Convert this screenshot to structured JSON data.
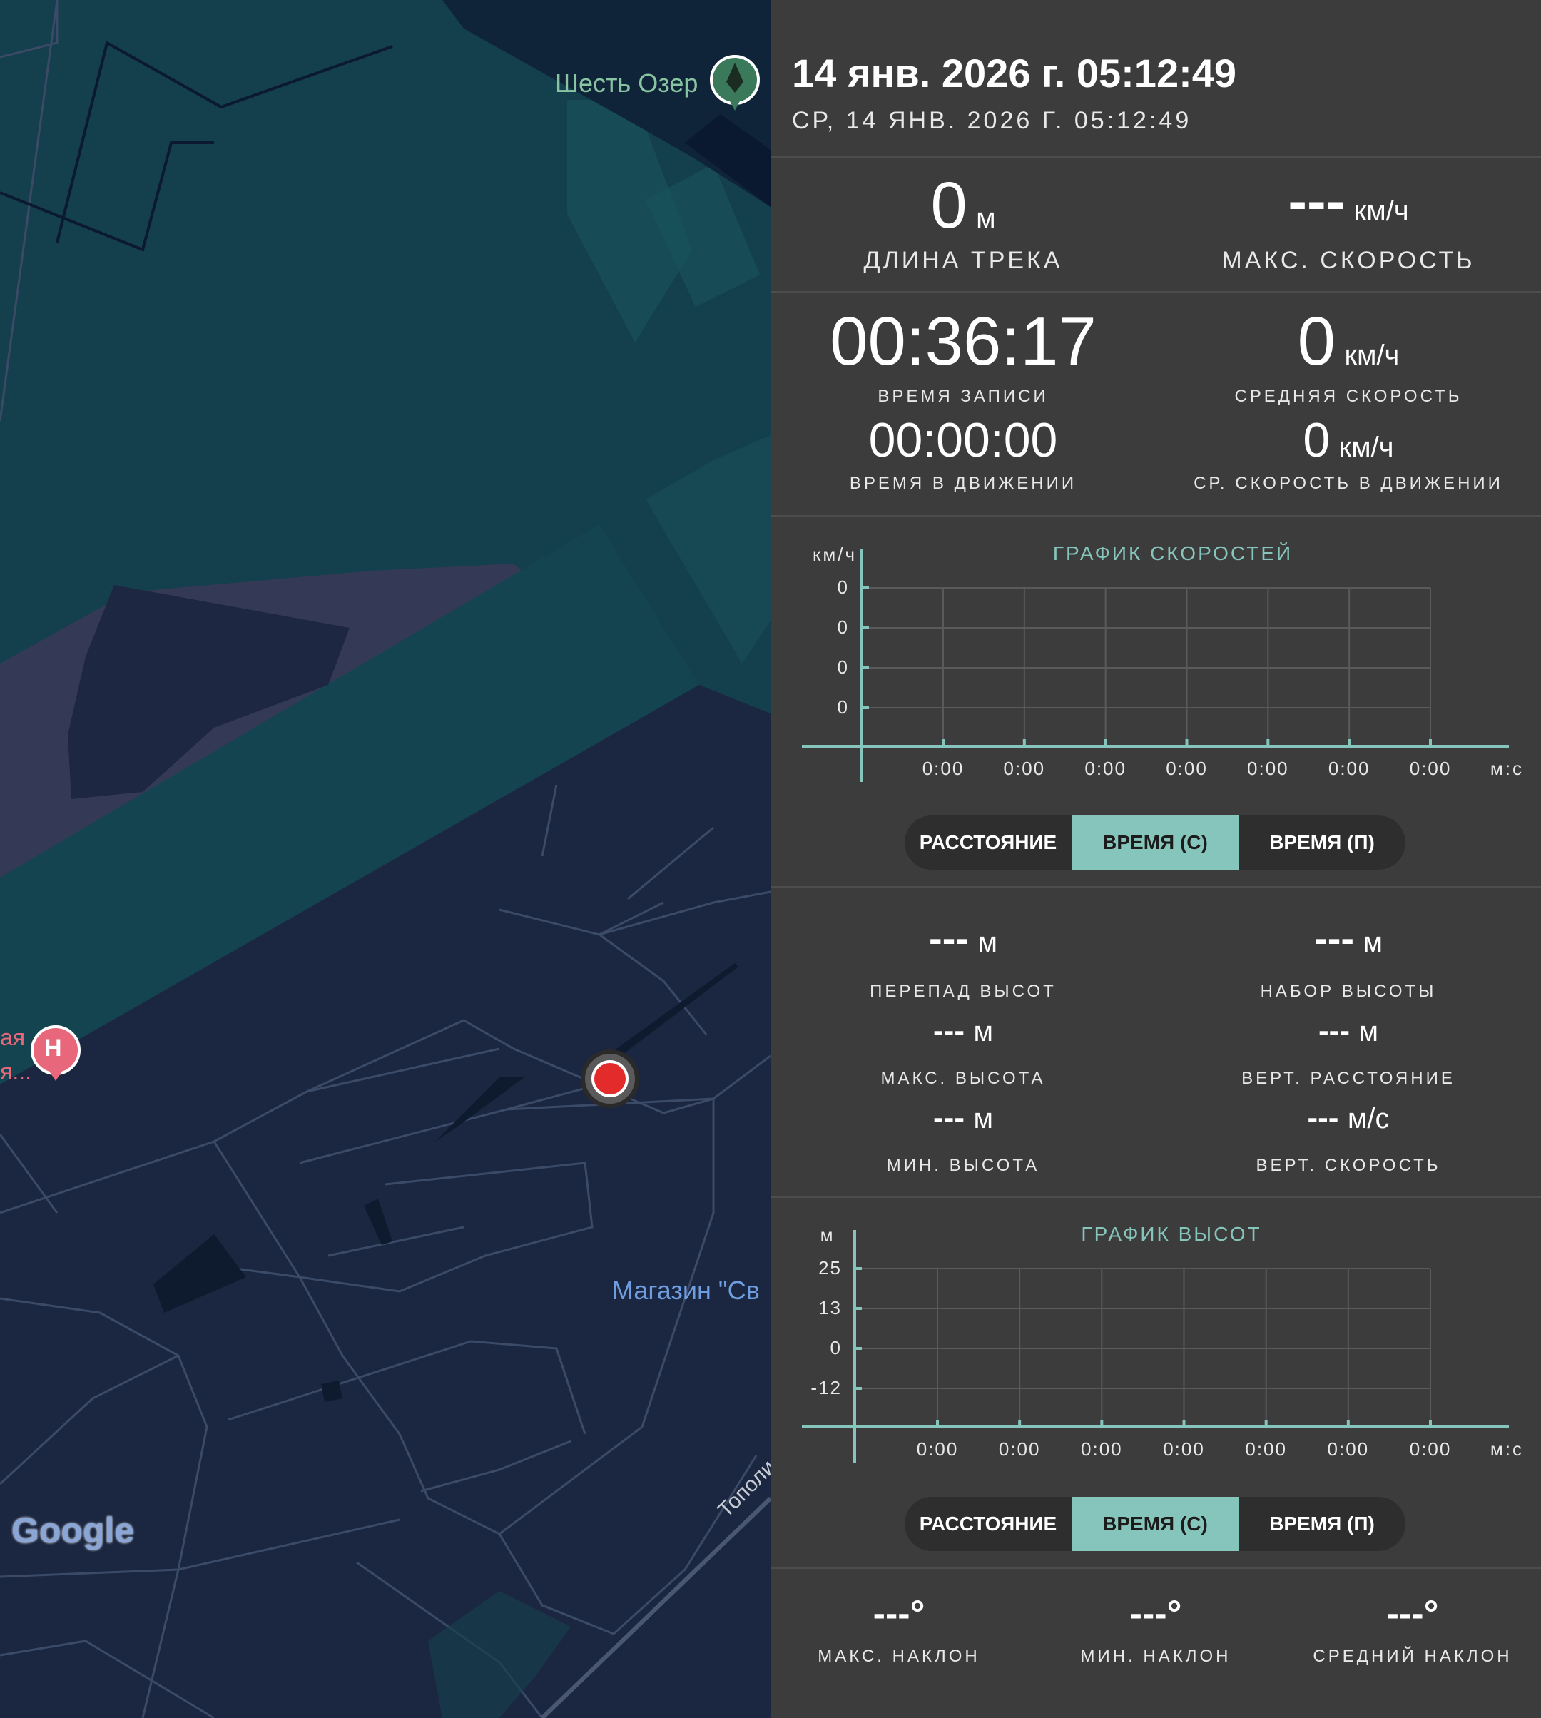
{
  "map": {
    "labels": {
      "poi_six_lakes": "Шесть Озер",
      "poi_shop": "Магазин \"Св",
      "poi_left_top": "ая",
      "poi_left_bottom": "я...",
      "road": "Тополи",
      "google": "Google",
      "hospital_letter": "H"
    },
    "colors": {
      "water": "#143f4d",
      "land": "#1b2741",
      "park": "#363b55"
    }
  },
  "header": {
    "datetime": "14 янв. 2026 г. 05:12:49",
    "datetime_sub": "СР, 14 ЯНВ. 2026 Г. 05:12:49"
  },
  "stats": {
    "track_length": {
      "value": "0",
      "unit": "м",
      "label": "ДЛИНА ТРЕКА"
    },
    "max_speed": {
      "value": "---",
      "unit": "км/ч",
      "label": "МАКС. СКОРОСТЬ"
    },
    "record_time": {
      "value": "00:36:17",
      "label": "ВРЕМЯ ЗАПИСИ"
    },
    "avg_speed": {
      "value": "0",
      "unit": "км/ч",
      "label": "СРЕДНЯЯ СКОРОСТЬ"
    },
    "moving_time": {
      "value": "00:00:00",
      "label": "ВРЕМЯ В ДВИЖЕНИИ"
    },
    "avg_moving_speed": {
      "value": "0",
      "unit": "км/ч",
      "label": "СР. СКОРОСТЬ В ДВИЖЕНИИ"
    }
  },
  "toggle_labels": {
    "distance": "РАССТОЯНИЕ",
    "time_c": "ВРЕМЯ (С)",
    "time_p": "ВРЕМЯ (П)"
  },
  "altitude": {
    "drop": {
      "value": "---",
      "unit": "м",
      "label": "ПЕРЕПАД ВЫСОТ"
    },
    "gain": {
      "value": "---",
      "unit": "м",
      "label": "НАБОР ВЫСОТЫ"
    },
    "max": {
      "value": "---",
      "unit": "м",
      "label": "МАКС. ВЫСОТА"
    },
    "vert_dist": {
      "value": "---",
      "unit": "м",
      "label": "ВЕРТ. РАССТОЯНИЕ"
    },
    "min": {
      "value": "---",
      "unit": "м",
      "label": "МИН. ВЫСОТА"
    },
    "vert_speed": {
      "value": "---",
      "unit": "м/с",
      "label": "ВЕРТ. СКОРОСТЬ"
    }
  },
  "slope": {
    "max": {
      "value": "---°",
      "label": "МАКС. НАКЛОН"
    },
    "min": {
      "value": "---°",
      "label": "МИН. НАКЛОН"
    },
    "avg": {
      "value": "---°",
      "label": "СРЕДНИЙ НАКЛОН"
    }
  },
  "chart_data": [
    {
      "type": "line",
      "title": "ГРАФИК СКОРОСТЕЙ",
      "ylabel": "км/ч",
      "xlabel": "м:с",
      "y_ticks": [
        "0",
        "0",
        "0",
        "0"
      ],
      "x_ticks": [
        "0:00",
        "0:00",
        "0:00",
        "0:00",
        "0:00",
        "0:00",
        "0:00"
      ],
      "series": [],
      "grid": true
    },
    {
      "type": "line",
      "title": "ГРАФИК ВЫСОТ",
      "ylabel": "м",
      "xlabel": "м:с",
      "y_ticks": [
        "25",
        "13",
        "0",
        "-12"
      ],
      "x_ticks": [
        "0:00",
        "0:00",
        "0:00",
        "0:00",
        "0:00",
        "0:00",
        "0:00"
      ],
      "series": [],
      "grid": true
    }
  ],
  "colors": {
    "accent": "#86c5bb",
    "panel": "#3c3c3c",
    "divider": "#4d4d4d",
    "record": "#e32b2b"
  }
}
